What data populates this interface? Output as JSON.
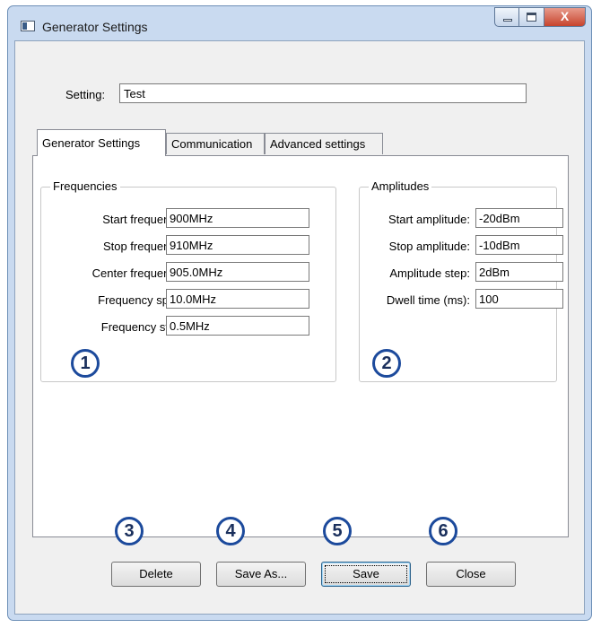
{
  "window": {
    "title": "Generator Settings",
    "close_glyph": "X"
  },
  "setting": {
    "label": "Setting:",
    "value": "Test"
  },
  "tabs": [
    {
      "label": "Generator Settings",
      "active": true
    },
    {
      "label": "Communication",
      "active": false
    },
    {
      "label": "Advanced settings",
      "active": false
    }
  ],
  "frequencies": {
    "title": "Frequencies",
    "fields": [
      {
        "label": "Start frequency:",
        "value": "900MHz"
      },
      {
        "label": "Stop frequency:",
        "value": "910MHz"
      },
      {
        "label": "Center frequency:",
        "value": "905.0MHz"
      },
      {
        "label": "Frequency span:",
        "value": "10.0MHz"
      },
      {
        "label": "Frequency step:",
        "value": "0.5MHz"
      }
    ]
  },
  "amplitudes": {
    "title": "Amplitudes",
    "fields": [
      {
        "label": "Start amplitude:",
        "value": "-20dBm"
      },
      {
        "label": "Stop amplitude:",
        "value": "-10dBm"
      },
      {
        "label": "Amplitude step:",
        "value": "2dBm"
      },
      {
        "label": "Dwell time (ms):",
        "value": "100"
      }
    ]
  },
  "buttons": {
    "delete": "Delete",
    "save_as": "Save As...",
    "save": "Save",
    "close": "Close"
  },
  "callouts": [
    "1",
    "2",
    "3",
    "4",
    "5",
    "6"
  ],
  "icons": {
    "app": "window-icon",
    "minimize": "minimize-icon",
    "maximize": "maximize-icon",
    "close": "close-icon"
  },
  "colors": {
    "callout_border": "#1c4a9c",
    "frame": "#c9daf0",
    "close_button": "#c7442d"
  }
}
